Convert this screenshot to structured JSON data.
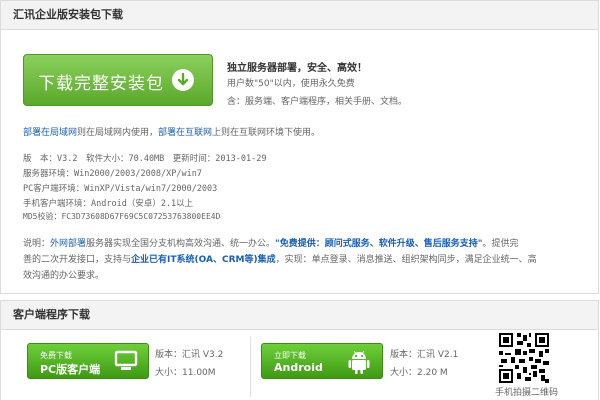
{
  "enterprise": {
    "title": "汇讯企业版安装包下载",
    "download_button": "下载完整安装包",
    "tagline": "独立服务器部署，安全、高效！",
    "feature_1": "用户数\"50\"以内，使用永久免费",
    "feature_2": "含：服务端、客户端程序，相关手册、文档。",
    "deploy": {
      "lan_link": "部署在局域网",
      "lan_text": "则在局域网内使用，",
      "internet_link": "部署在互联网",
      "internet_text": "上则在互联网环境下使用。"
    },
    "info": {
      "version_line": "版　本：V3.2　软件大小：70.40MB　更新时间：2013-01-29",
      "server_env": "服务器环境：Win2000/2003/2008/XP/win7",
      "pc_env": "PC客户端环境：WinXP/Vista/win7/2000/2003",
      "mobile_env": "手机客户端环境：Android（安卓）2.1以上",
      "md5": "MD5校验：FC3D73608D67F69C5C07253763800EE4D"
    },
    "desc": {
      "prefix": "说明：",
      "link1": "外网部署",
      "text1": "服务器实现全国分支机构高效沟通、统一办公。",
      "link2": "\"免费提供：顾问式服务、软件升级、售后服务支持\"",
      "text2": "。提供完",
      "line2_text1": "善的二次开发接口，支持与",
      "link3": "企业已有IT系统(OA、CRM等)集成",
      "line2_text2": "，实现：单点登录、消息推送、组织架构同步，满足企业统一、高",
      "line3": "效沟通的办公要求。"
    }
  },
  "client": {
    "title": "客户端程序下载",
    "pc": {
      "btn_line1": "免费下载",
      "btn_line2": "PC版客户端",
      "version": "版本：汇讯 V3.2",
      "size": "大小：11.00M"
    },
    "android": {
      "btn_line1": "立即下载",
      "btn_line2": "Android",
      "version": "版本：汇讯 V2.1",
      "size": "大小：2.20 M"
    },
    "qr_caption": "手机拍摄二维码"
  },
  "colors": {
    "green": "#5aa82c",
    "link": "#1a5fb4",
    "tagline": "#333333"
  }
}
